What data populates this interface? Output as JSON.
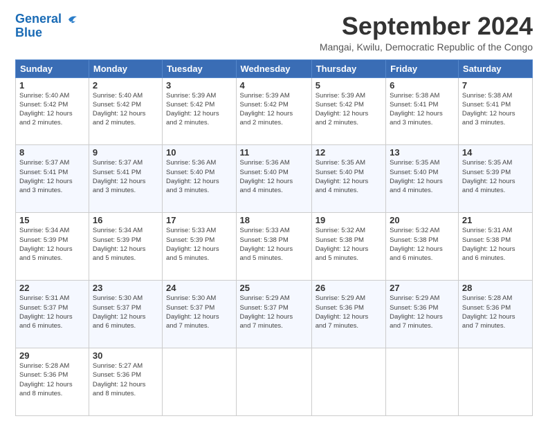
{
  "header": {
    "logo_line1": "General",
    "logo_line2": "Blue",
    "month": "September 2024",
    "location": "Mangai, Kwilu, Democratic Republic of the Congo"
  },
  "days_of_week": [
    "Sunday",
    "Monday",
    "Tuesday",
    "Wednesday",
    "Thursday",
    "Friday",
    "Saturday"
  ],
  "weeks": [
    [
      {
        "day": 1,
        "info": "Sunrise: 5:40 AM\nSunset: 5:42 PM\nDaylight: 12 hours\nand 2 minutes."
      },
      {
        "day": 2,
        "info": "Sunrise: 5:40 AM\nSunset: 5:42 PM\nDaylight: 12 hours\nand 2 minutes."
      },
      {
        "day": 3,
        "info": "Sunrise: 5:39 AM\nSunset: 5:42 PM\nDaylight: 12 hours\nand 2 minutes."
      },
      {
        "day": 4,
        "info": "Sunrise: 5:39 AM\nSunset: 5:42 PM\nDaylight: 12 hours\nand 2 minutes."
      },
      {
        "day": 5,
        "info": "Sunrise: 5:39 AM\nSunset: 5:42 PM\nDaylight: 12 hours\nand 2 minutes."
      },
      {
        "day": 6,
        "info": "Sunrise: 5:38 AM\nSunset: 5:41 PM\nDaylight: 12 hours\nand 3 minutes."
      },
      {
        "day": 7,
        "info": "Sunrise: 5:38 AM\nSunset: 5:41 PM\nDaylight: 12 hours\nand 3 minutes."
      }
    ],
    [
      {
        "day": 8,
        "info": "Sunrise: 5:37 AM\nSunset: 5:41 PM\nDaylight: 12 hours\nand 3 minutes."
      },
      {
        "day": 9,
        "info": "Sunrise: 5:37 AM\nSunset: 5:41 PM\nDaylight: 12 hours\nand 3 minutes."
      },
      {
        "day": 10,
        "info": "Sunrise: 5:36 AM\nSunset: 5:40 PM\nDaylight: 12 hours\nand 3 minutes."
      },
      {
        "day": 11,
        "info": "Sunrise: 5:36 AM\nSunset: 5:40 PM\nDaylight: 12 hours\nand 4 minutes."
      },
      {
        "day": 12,
        "info": "Sunrise: 5:35 AM\nSunset: 5:40 PM\nDaylight: 12 hours\nand 4 minutes."
      },
      {
        "day": 13,
        "info": "Sunrise: 5:35 AM\nSunset: 5:40 PM\nDaylight: 12 hours\nand 4 minutes."
      },
      {
        "day": 14,
        "info": "Sunrise: 5:35 AM\nSunset: 5:39 PM\nDaylight: 12 hours\nand 4 minutes."
      }
    ],
    [
      {
        "day": 15,
        "info": "Sunrise: 5:34 AM\nSunset: 5:39 PM\nDaylight: 12 hours\nand 5 minutes."
      },
      {
        "day": 16,
        "info": "Sunrise: 5:34 AM\nSunset: 5:39 PM\nDaylight: 12 hours\nand 5 minutes."
      },
      {
        "day": 17,
        "info": "Sunrise: 5:33 AM\nSunset: 5:39 PM\nDaylight: 12 hours\nand 5 minutes."
      },
      {
        "day": 18,
        "info": "Sunrise: 5:33 AM\nSunset: 5:38 PM\nDaylight: 12 hours\nand 5 minutes."
      },
      {
        "day": 19,
        "info": "Sunrise: 5:32 AM\nSunset: 5:38 PM\nDaylight: 12 hours\nand 5 minutes."
      },
      {
        "day": 20,
        "info": "Sunrise: 5:32 AM\nSunset: 5:38 PM\nDaylight: 12 hours\nand 6 minutes."
      },
      {
        "day": 21,
        "info": "Sunrise: 5:31 AM\nSunset: 5:38 PM\nDaylight: 12 hours\nand 6 minutes."
      }
    ],
    [
      {
        "day": 22,
        "info": "Sunrise: 5:31 AM\nSunset: 5:37 PM\nDaylight: 12 hours\nand 6 minutes."
      },
      {
        "day": 23,
        "info": "Sunrise: 5:30 AM\nSunset: 5:37 PM\nDaylight: 12 hours\nand 6 minutes."
      },
      {
        "day": 24,
        "info": "Sunrise: 5:30 AM\nSunset: 5:37 PM\nDaylight: 12 hours\nand 7 minutes."
      },
      {
        "day": 25,
        "info": "Sunrise: 5:29 AM\nSunset: 5:37 PM\nDaylight: 12 hours\nand 7 minutes."
      },
      {
        "day": 26,
        "info": "Sunrise: 5:29 AM\nSunset: 5:36 PM\nDaylight: 12 hours\nand 7 minutes."
      },
      {
        "day": 27,
        "info": "Sunrise: 5:29 AM\nSunset: 5:36 PM\nDaylight: 12 hours\nand 7 minutes."
      },
      {
        "day": 28,
        "info": "Sunrise: 5:28 AM\nSunset: 5:36 PM\nDaylight: 12 hours\nand 7 minutes."
      }
    ],
    [
      {
        "day": 29,
        "info": "Sunrise: 5:28 AM\nSunset: 5:36 PM\nDaylight: 12 hours\nand 8 minutes."
      },
      {
        "day": 30,
        "info": "Sunrise: 5:27 AM\nSunset: 5:36 PM\nDaylight: 12 hours\nand 8 minutes."
      },
      null,
      null,
      null,
      null,
      null
    ]
  ]
}
